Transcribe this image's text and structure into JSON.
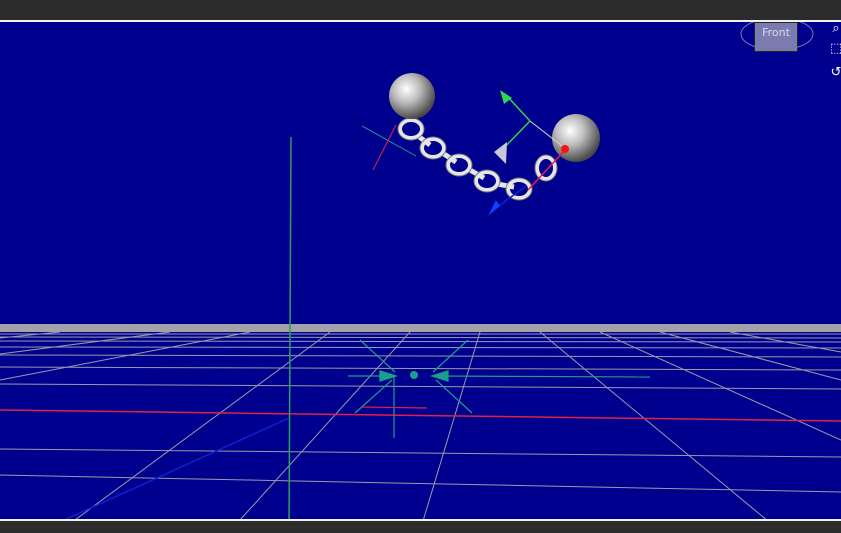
{
  "viewcube": {
    "face_label": "Front"
  },
  "nav_tools": [
    {
      "icon": "zoom-icon"
    },
    {
      "icon": "frame-selection-icon"
    },
    {
      "icon": "orbit-icon"
    }
  ],
  "colors": {
    "viewport_bg": "#00008e",
    "grid": "#9a9aa8",
    "x_axis": "#e0204a",
    "y_axis": "#2e9e5e",
    "z_axis": "#1020d0",
    "selection": "#1aa08a"
  }
}
